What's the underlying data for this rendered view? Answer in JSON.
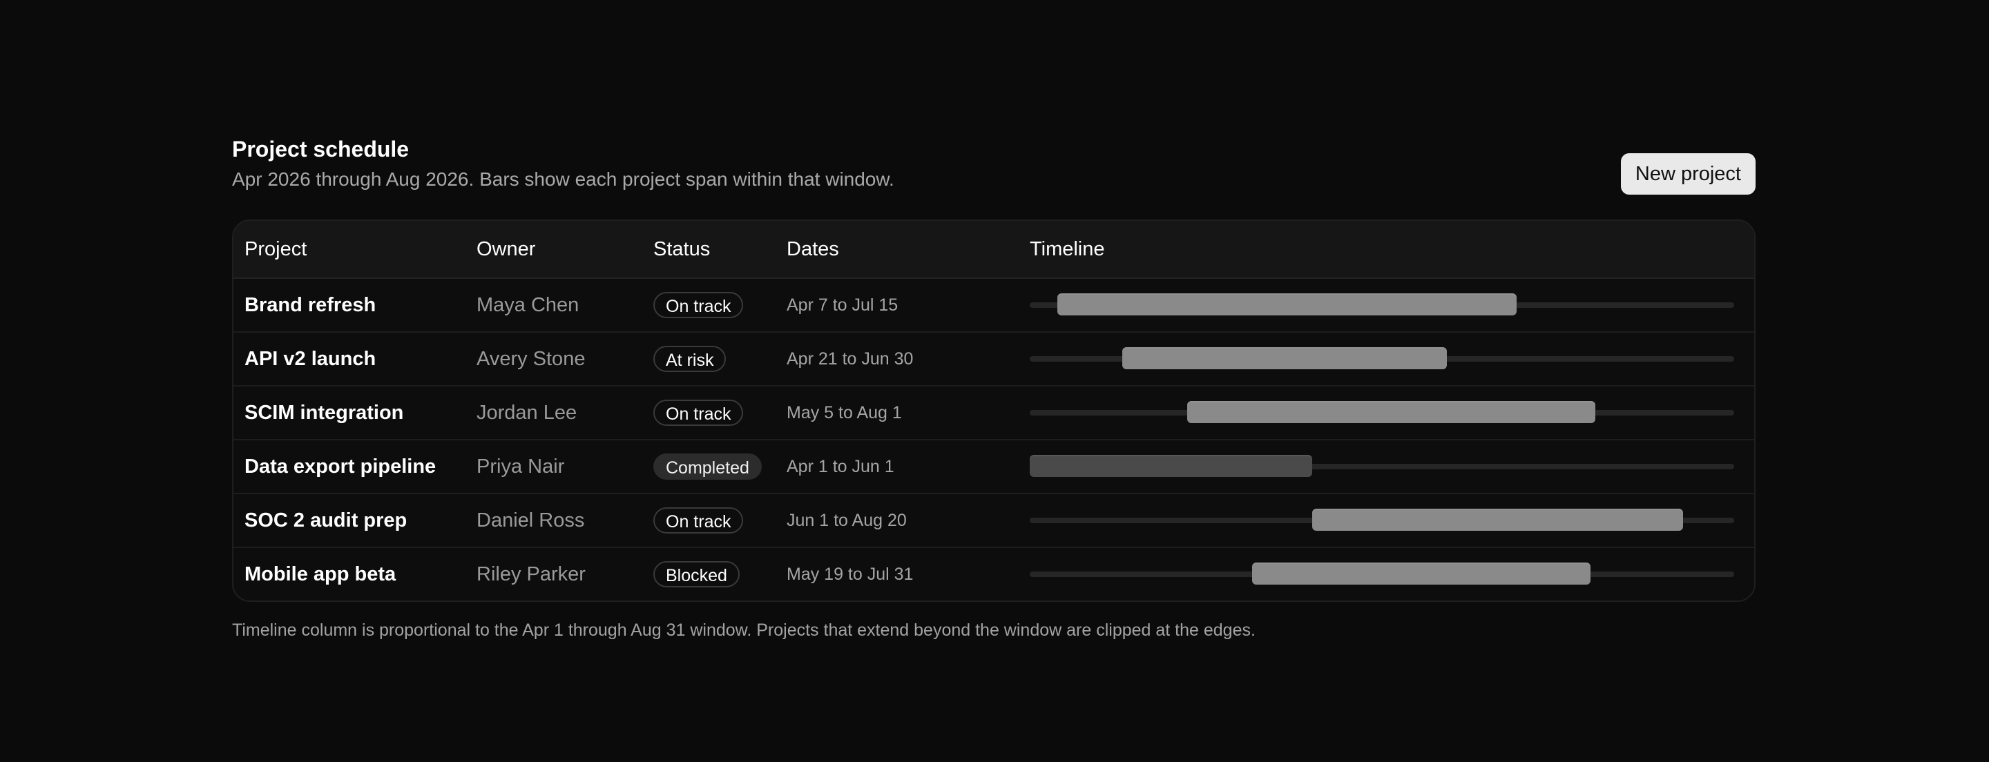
{
  "header": {
    "title": "Project schedule",
    "subtitle": "Apr 2026 through Aug 2026. Bars show each project span within that window.",
    "new_button_label": "New project"
  },
  "window": {
    "start": "2026-04-01",
    "end": "2026-08-31"
  },
  "columns": [
    "Project",
    "Owner",
    "Status",
    "Dates",
    "Timeline"
  ],
  "rows": [
    {
      "project": "Brand refresh",
      "owner": "Maya Chen",
      "status": "On track",
      "status_kind": "outline",
      "dates": "Apr 7 to Jul 15",
      "start": "2026-04-07",
      "end": "2026-07-15"
    },
    {
      "project": "API v2 launch",
      "owner": "Avery Stone",
      "status": "At risk",
      "status_kind": "outline",
      "dates": "Apr 21 to Jun 30",
      "start": "2026-04-21",
      "end": "2026-06-30"
    },
    {
      "project": "SCIM integration",
      "owner": "Jordan Lee",
      "status": "On track",
      "status_kind": "outline",
      "dates": "May 5 to Aug 1",
      "start": "2026-05-05",
      "end": "2026-08-01"
    },
    {
      "project": "Data export pipeline",
      "owner": "Priya Nair",
      "status": "Completed",
      "status_kind": "completed",
      "dates": "Apr 1 to Jun 1",
      "start": "2026-04-01",
      "end": "2026-06-01"
    },
    {
      "project": "SOC 2 audit prep",
      "owner": "Daniel Ross",
      "status": "On track",
      "status_kind": "outline",
      "dates": "Jun 1 to Aug 20",
      "start": "2026-06-01",
      "end": "2026-08-20"
    },
    {
      "project": "Mobile app beta",
      "owner": "Riley Parker",
      "status": "Blocked",
      "status_kind": "outline",
      "dates": "May 19 to Jul 31",
      "start": "2026-05-19",
      "end": "2026-07-31"
    }
  ],
  "footnote": "Timeline column is proportional to the Apr 1 through Aug 31 window. Projects that extend beyond the window are clipped at the edges."
}
